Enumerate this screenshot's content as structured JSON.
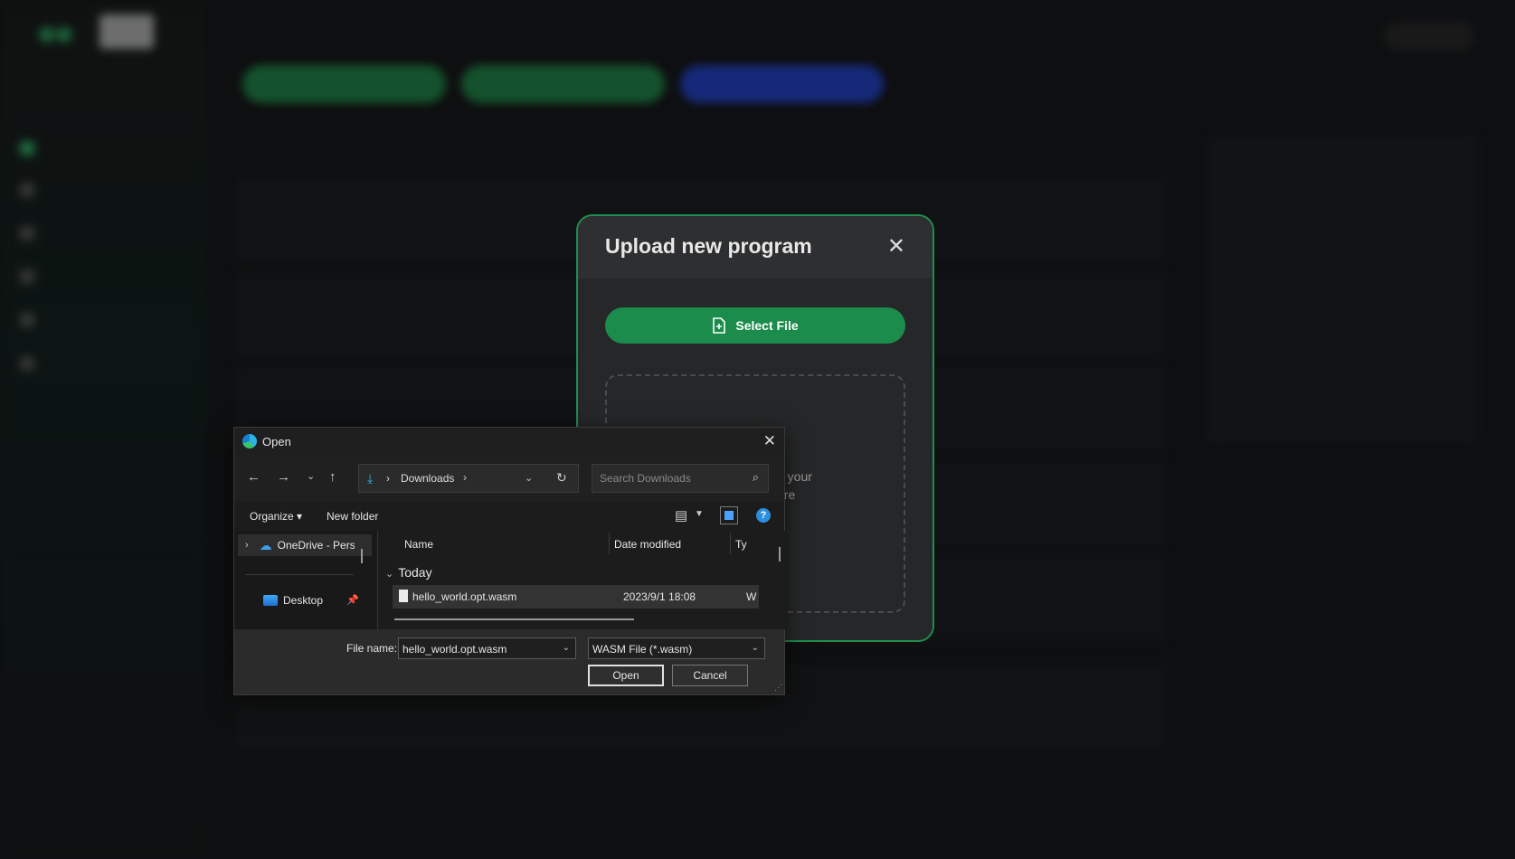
{
  "upload_modal": {
    "title": "Upload new program",
    "close_symbol": "✕",
    "select_file_label": "Select File",
    "drop_text_line1": "o your",
    "drop_text_line2": "ere"
  },
  "open_dialog": {
    "title": "Open",
    "close_symbol": "✕",
    "address": {
      "location": "Downloads"
    },
    "search_placeholder": "Search Downloads",
    "commands": {
      "organize": "Organize ▾",
      "new_folder": "New folder",
      "help": "?"
    },
    "nav_pane": {
      "onedrive_label": "OneDrive - Perso",
      "desktop_label": "Desktop"
    },
    "columns": [
      "Name",
      "Date modified",
      "Ty"
    ],
    "group_label": "Today",
    "files": [
      {
        "name": "hello_world.opt.wasm",
        "date": "2023/9/1 18:08",
        "type": "W"
      }
    ],
    "file_name_label": "File name:",
    "file_name_value": "hello_world.opt.wasm",
    "file_type_value": "WASM File (*.wasm)",
    "open_label": "Open",
    "cancel_label": "Cancel"
  },
  "colors": {
    "accent_green": "#1c8c4c",
    "modal_border": "#1f8f4f",
    "dialog_bg": "#202020"
  }
}
